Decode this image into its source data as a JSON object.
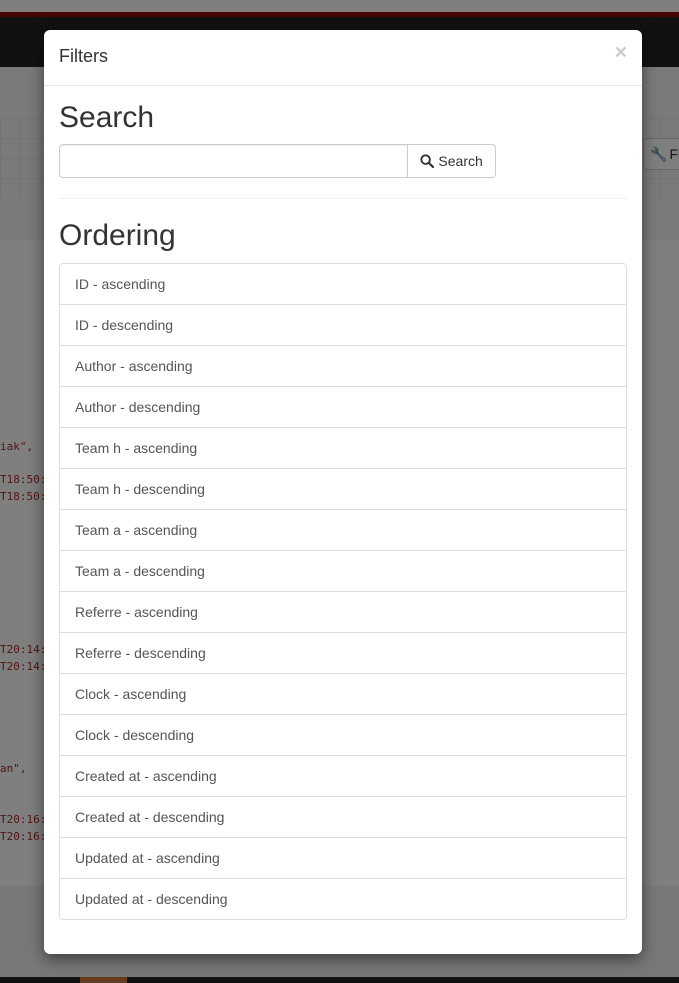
{
  "background": {
    "toolbar_button_label": "Fi",
    "code_fragments": [
      "iak\",",
      "T18:50:",
      "T18:50:",
      "T20:14:",
      "T20:14:",
      "an\",",
      "T20:16:",
      "T20:16:"
    ]
  },
  "modal": {
    "title": "Filters",
    "close_label": "×",
    "search": {
      "heading": "Search",
      "input_value": "",
      "input_placeholder": "",
      "button_label": "Search",
      "button_icon": "search-icon"
    },
    "ordering": {
      "heading": "Ordering",
      "items": [
        "ID - ascending",
        "ID - descending",
        "Author - ascending",
        "Author - descending",
        "Team h - ascending",
        "Team h - descending",
        "Team a - ascending",
        "Team a - descending",
        "Referre - ascending",
        "Referre - descending",
        "Clock - ascending",
        "Clock - descending",
        "Created at - ascending",
        "Created at - descending",
        "Updated at - ascending",
        "Updated at - descending"
      ]
    }
  },
  "colors": {
    "navbar": "#222222",
    "accent_red": "#8b0a0a",
    "code_text": "#a52a2a",
    "heading_text": "#333333",
    "list_text": "#555555"
  }
}
